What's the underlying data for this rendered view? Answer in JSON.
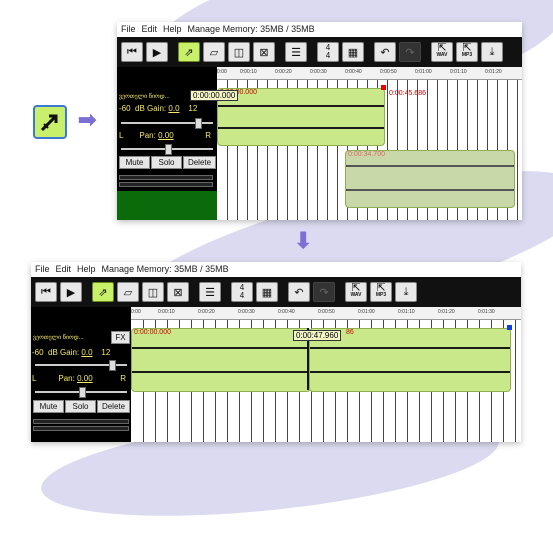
{
  "top": {
    "menu": {
      "file": "File",
      "edit": "Edit",
      "help": "Help",
      "memory": "Manage Memory: 35MB / 35MB"
    },
    "toolbar": {
      "time_sig_top": "4",
      "time_sig_bottom": "4",
      "wav_label": "WAV",
      "mp3_label": "MP3"
    },
    "ruler": [
      "0:00",
      "0:00:10",
      "0:00:20",
      "0:00:30",
      "0:00:40",
      "0:00:50",
      "0:01:00",
      "0:01:10",
      "0:01:20"
    ],
    "track": {
      "name": "ვეოთელი წიოდ...",
      "gain_label": "dB Gain:",
      "gain_value": "0.0",
      "gain_min": "-60",
      "gain_max": "12",
      "pan_label": "Pan:",
      "pan_value": "0.00",
      "pan_left": "L",
      "pan_right": "R",
      "mute": "Mute",
      "solo": "Solo",
      "delete": "Delete"
    },
    "playhead_time": "0:00:00.000",
    "clip1_label": "0:00:00.000",
    "clip1_end": "0:00:45.686",
    "clip2_label": "0:00:34.700"
  },
  "bottom": {
    "menu": {
      "file": "File",
      "edit": "Edit",
      "help": "Help",
      "memory": "Manage Memory: 35MB / 35MB"
    },
    "toolbar": {
      "time_sig_top": "4",
      "time_sig_bottom": "4",
      "wav_label": "WAV",
      "mp3_label": "MP3"
    },
    "ruler": [
      "0:00",
      "0:00:10",
      "0:00:20",
      "0:00:30",
      "0:00:40",
      "0:00:50",
      "0:01:00",
      "0:01:10",
      "0:01:20",
      "0:01:30"
    ],
    "track": {
      "name": "ვეოთელი წიოდ...",
      "fx": "FX",
      "gain_label": "dB Gain:",
      "gain_value": "0.0",
      "gain_min": "-60",
      "gain_max": "12",
      "pan_label": "Pan:",
      "pan_value": "0.00",
      "pan_left": "L",
      "pan_right": "R",
      "mute": "Mute",
      "solo": "Solo",
      "delete": "Delete"
    },
    "clip1_label": "0:00:00.000",
    "clip2_label": "86",
    "join_time": "0:00:47.960"
  },
  "colors": {
    "accent_green": "#c9f06a",
    "clip_green": "#c9e88a",
    "arrow": "#7b6fd6",
    "blob": "#dcdaf0"
  },
  "icons": [
    "skip-back-icon",
    "play-icon",
    "select-tool-icon",
    "eraser-icon",
    "split-icon",
    "delete-icon",
    "equalizer-icon",
    "metronome-icon",
    "undo-icon",
    "redo-icon",
    "export-wav-icon",
    "export-mp3-icon",
    "download-icon"
  ]
}
